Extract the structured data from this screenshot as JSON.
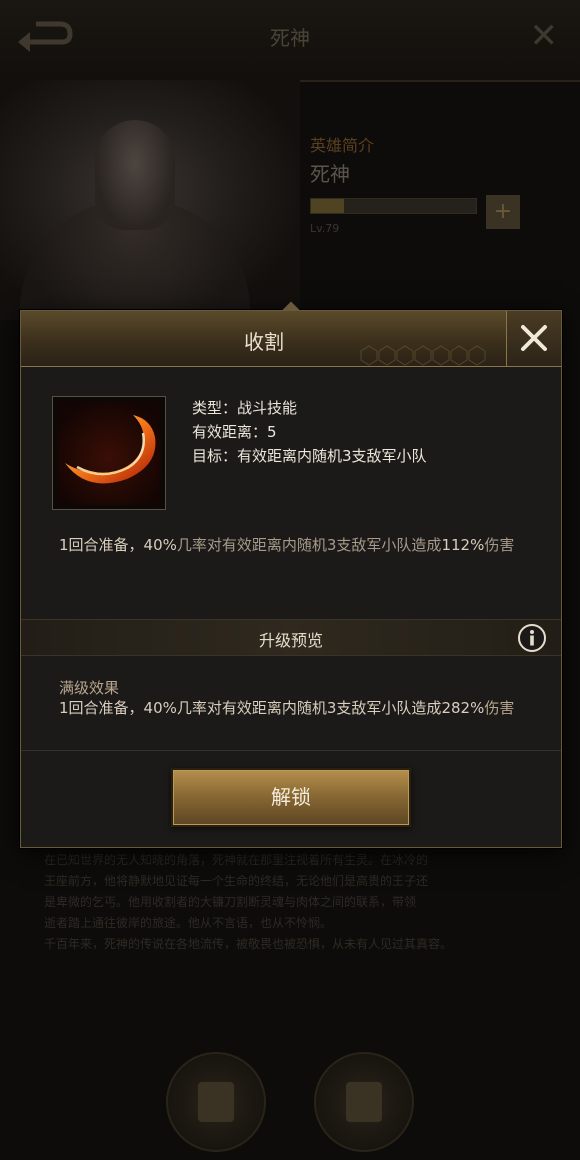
{
  "background": {
    "title": "死神",
    "hero_subtitle": "英雄简介",
    "hero_name": "死神",
    "level_label": "Lv.79",
    "progress": 0.2,
    "story_lines": [
      "在已知世界的无人知晓的角落，死神就在那里注视着所有生灵。在冰冷的",
      "王座前方，他将静默地见证每一个生命的终结，无论他们是高贵的王子还",
      "是卑微的乞丐。他用收割者的大镰刀割断灵魂与肉体之间的联系，带领",
      "逝者踏上通往彼岸的旅途。他从不言语，也从不怜悯。",
      "千百年来，死神的传说在各地流传，被敬畏也被恐惧，从未有人见过其真容。"
    ]
  },
  "modal": {
    "title": "收割",
    "skill_type": "类型：战斗技能",
    "skill_range": "有效距离：5",
    "skill_target": "目标：有效距离内随机3支敌军小队",
    "description_parts": [
      "1回合准备，",
      "40%",
      "几率对有效距离内随机3支敌军小队造成",
      "112%",
      "伤害"
    ],
    "upgrade_preview_title": "升级预览",
    "max_level_label": "满级效果",
    "max_description_parts": [
      "1回合准备，",
      "40%",
      "几率对有效距离内随机3支敌军小队造成",
      "282%",
      "伤害"
    ],
    "unlock_button": "解锁"
  },
  "colors": {
    "accent_gold": "#b58f4c",
    "text_primary": "#ece6da",
    "text_secondary": "#a8998a"
  },
  "icons": [
    "back-arrow-icon",
    "close-icon",
    "plus-icon",
    "skill-slash-icon",
    "info-icon",
    "rank-emblem-icon",
    "map-icon"
  ]
}
